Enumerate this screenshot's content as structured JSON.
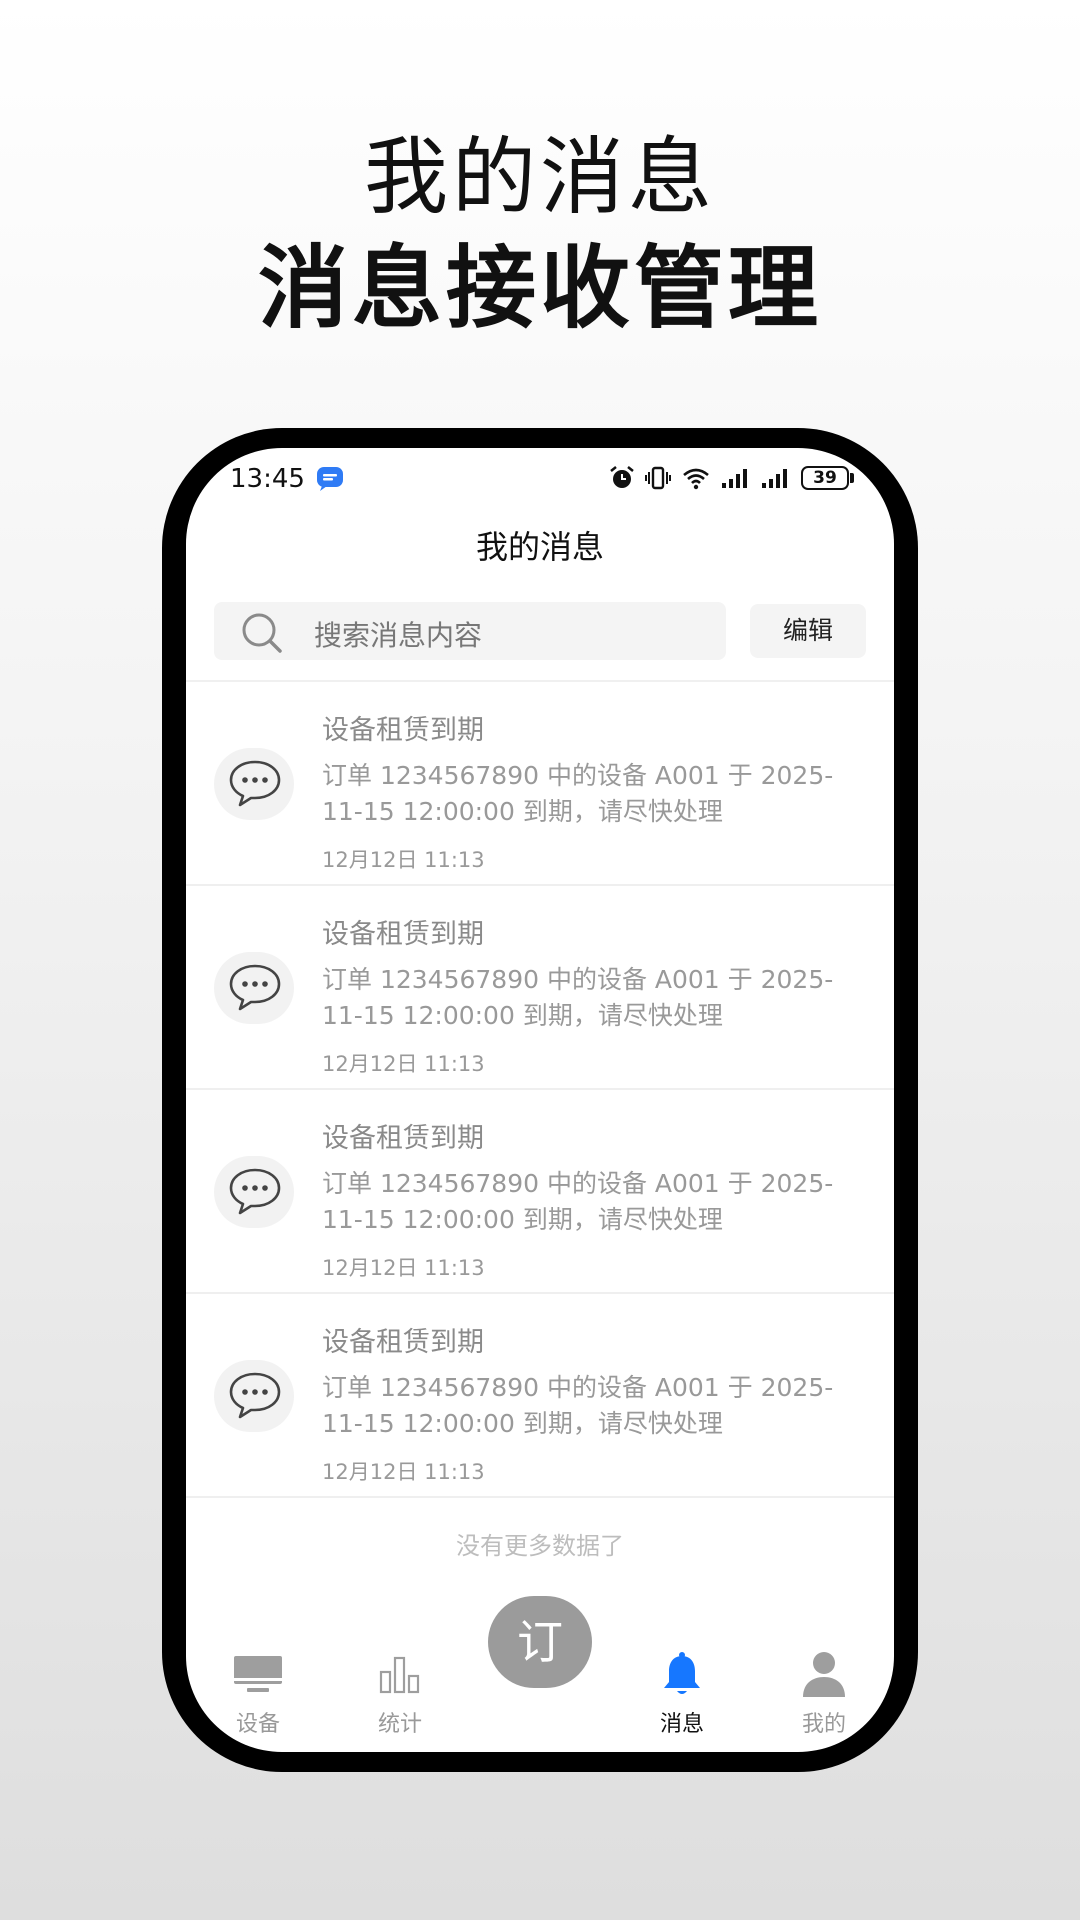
{
  "promo": {
    "title": "我的消息",
    "subtitle": "消息接收管理"
  },
  "status_bar": {
    "time": "13:45",
    "battery": "39",
    "icons": [
      "chat-bubble-icon",
      "alarm-icon",
      "vibrate-icon",
      "wifi-icon",
      "signal-icon",
      "signal-icon",
      "battery-icon"
    ]
  },
  "page": {
    "title": "我的消息"
  },
  "search": {
    "placeholder": "搜索消息内容",
    "edit_label": "编辑"
  },
  "messages": [
    {
      "title": "设备租赁到期",
      "body": "订单 1234567890 中的设备 A001 于 2025-11-15 12:00:00 到期，请尽快处理",
      "time": "12月12日 11:13"
    },
    {
      "title": "设备租赁到期",
      "body": "订单 1234567890 中的设备 A001 于 2025-11-15 12:00:00 到期，请尽快处理",
      "time": "12月12日 11:13"
    },
    {
      "title": "设备租赁到期",
      "body": "订单 1234567890 中的设备 A001 于 2025-11-15 12:00:00 到期，请尽快处理",
      "time": "12月12日 11:13"
    },
    {
      "title": "设备租赁到期",
      "body": "订单 1234567890 中的设备 A001 于 2025-11-15 12:00:00 到期，请尽快处理",
      "time": "12月12日 11:13"
    }
  ],
  "list_footer": "没有更多数据了",
  "tabbar": {
    "tabs": [
      {
        "label": "设备",
        "icon": "monitor-icon"
      },
      {
        "label": "统计",
        "icon": "bar-chart-icon"
      },
      {
        "label": "消息",
        "icon": "bell-icon",
        "active": true
      },
      {
        "label": "我的",
        "icon": "user-icon"
      }
    ],
    "center_label": "订"
  },
  "colors": {
    "active_tab": "#1677ff",
    "inactive_tab": "#a0a0a0",
    "center_button": "#9b9b9b"
  }
}
